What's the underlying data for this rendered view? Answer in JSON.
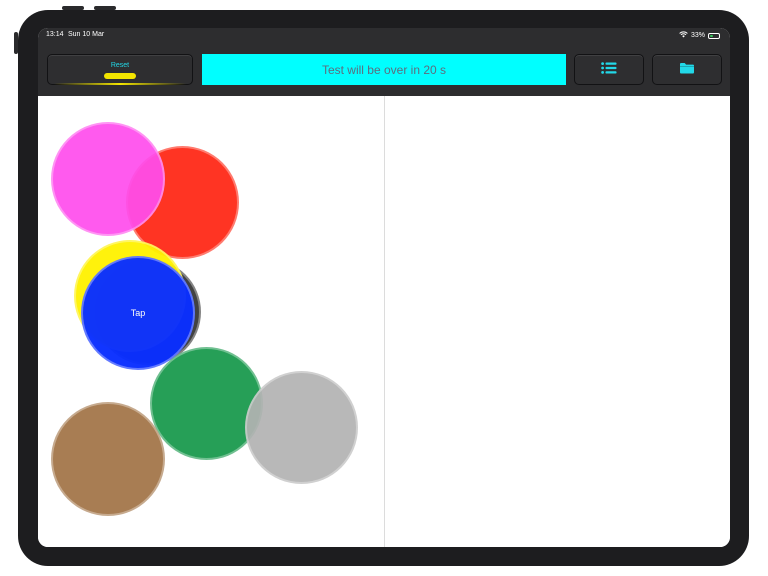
{
  "status_bar": {
    "time": "13:14",
    "date": "Sun 10 Mar",
    "battery_percent": "33%",
    "battery_level": 0.33,
    "icons": [
      "wifi-icon",
      "battery-charging-icon"
    ]
  },
  "toolbar": {
    "reset_label": "Reset",
    "message": "Test will be over in 20 s",
    "list_icon": "list-icon",
    "folder_icon": "folder-icon"
  },
  "targets": {
    "tap_label": "Tap",
    "circles": [
      {
        "name": "red-circle",
        "color": "#ff2a18"
      },
      {
        "name": "magenta-circle",
        "color": "#ff4ded"
      },
      {
        "name": "black-circle",
        "color": "#222222"
      },
      {
        "name": "yellow-circle",
        "color": "#fff200"
      },
      {
        "name": "blue-circle",
        "color": "#0a2fff"
      },
      {
        "name": "green-circle",
        "color": "#1b9a4f"
      },
      {
        "name": "brown-circle",
        "color": "#a4774a"
      },
      {
        "name": "gray-circle",
        "color": "#b3b3b3"
      }
    ]
  },
  "colors": {
    "accent": "#22d8e8",
    "banner": "#00ffff",
    "reset_indicator": "#f3e500"
  }
}
